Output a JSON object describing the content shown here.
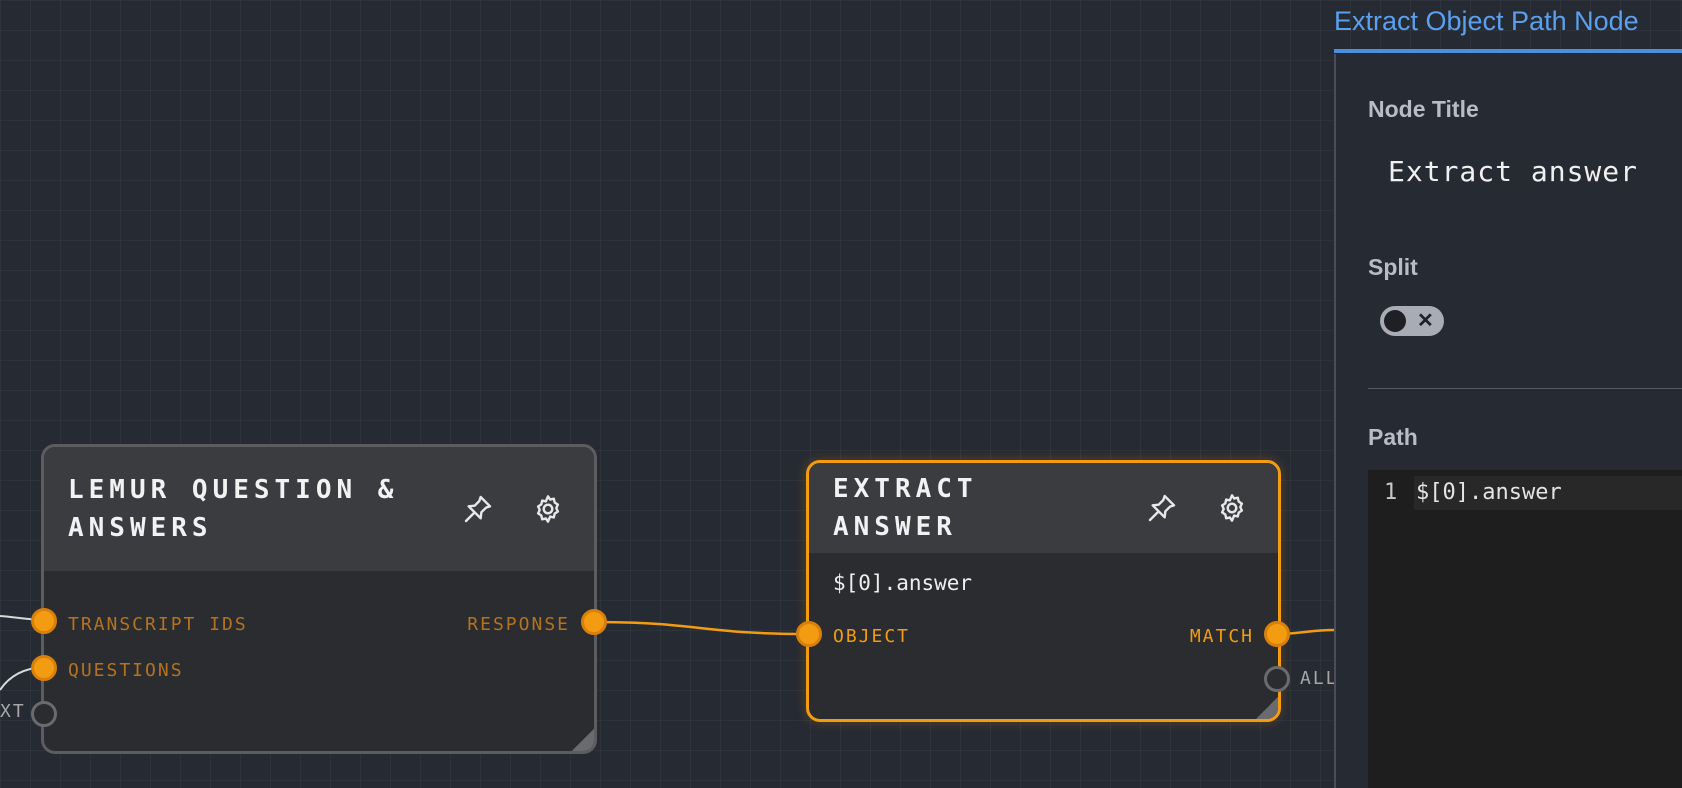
{
  "canvas": {
    "nodes": {
      "lemur": {
        "title": "LEMUR QUESTION & ANSWERS",
        "inputs": [
          {
            "label": "TRANSCRIPT IDS",
            "connected": true
          },
          {
            "label": "QUESTIONS",
            "connected": true
          },
          {
            "label": "XT",
            "connected": false
          }
        ],
        "outputs": [
          {
            "label": "RESPONSE",
            "connected": true
          }
        ]
      },
      "extract": {
        "title": "EXTRACT ANSWER",
        "path_preview": "$[0].answer",
        "inputs": [
          {
            "label": "OBJECT",
            "connected": true
          }
        ],
        "outputs": [
          {
            "label": "MATCH",
            "connected": true
          },
          {
            "label": "ALL",
            "connected": false
          }
        ]
      }
    },
    "header_icons": [
      "pin-icon",
      "gear-icon"
    ],
    "colors": {
      "accent_orange": "#f39c12",
      "panel_tab_blue": "#4b8fe0",
      "background": "#262a33"
    }
  },
  "panel": {
    "tab_label": "Extract Object Path Node",
    "node_title_label": "Node Title",
    "node_title_value": "Extract answer",
    "split_label": "Split",
    "split_enabled": false,
    "path_label": "Path",
    "editor": {
      "line_number": "1",
      "code": "$[0].answer"
    }
  }
}
